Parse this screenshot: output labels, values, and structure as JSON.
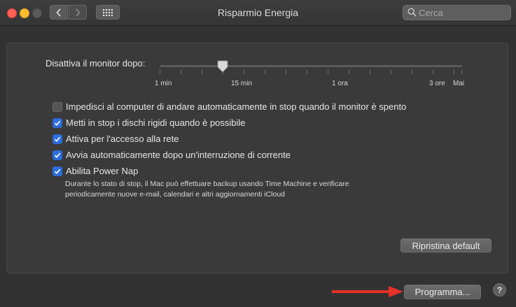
{
  "window": {
    "title": "Risparmio Energia"
  },
  "search": {
    "placeholder": "Cerca"
  },
  "slider": {
    "label": "Disattiva il monitor dopo:",
    "tick_labels": [
      "1 min",
      "15 min",
      "1 ora",
      "3 ore",
      "Mai"
    ],
    "selected": "15 min"
  },
  "options": [
    {
      "label": "Impedisci al computer di andare automaticamente in stop quando il monitor è spento",
      "checked": false
    },
    {
      "label": "Metti in stop i dischi rigidi quando è possibile",
      "checked": true
    },
    {
      "label": "Attiva per l'accesso alla rete",
      "checked": true
    },
    {
      "label": "Avvia automaticamente dopo un'interruzione di corrente",
      "checked": true
    },
    {
      "label": "Abilita Power Nap",
      "checked": true
    }
  ],
  "power_nap_desc": {
    "line1": "Durante lo stato di stop, il Mac può effettuare backup usando Time Machine e verificare",
    "line2": "periodicamente nuove e-mail, calendari e altri aggiornamenti iCloud"
  },
  "buttons": {
    "reset": "Ripristina default",
    "schedule": "Programma...",
    "help": "?"
  },
  "colors": {
    "accent": "#2d6fe0",
    "arrow": "#e53228",
    "close": "#fe5f57",
    "minimize": "#febc2e"
  },
  "icons": [
    "chevron-left-icon",
    "chevron-right-icon",
    "grid-icon",
    "search-icon",
    "slider-thumb-icon",
    "checkmark-icon",
    "arrow-right-icon"
  ]
}
